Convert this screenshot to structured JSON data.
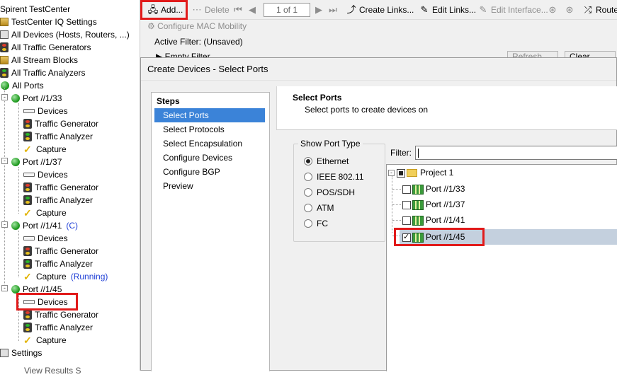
{
  "tree": {
    "root": "Spirent TestCenter",
    "items": [
      {
        "label": "TestCenter IQ Settings",
        "icon": "iq-settings-icon"
      },
      {
        "label": "All Devices (Hosts, Routers, ...)",
        "icon": "devices-folder-icon"
      },
      {
        "label": "All Traffic Generators",
        "icon": "traffic-generator-icon"
      },
      {
        "label": "All Stream Blocks",
        "icon": "stream-blocks-icon"
      },
      {
        "label": "All Traffic Analyzers",
        "icon": "traffic-analyzer-icon"
      },
      {
        "label": "All Ports",
        "icon": "globe-icon"
      }
    ],
    "ports": [
      {
        "label": "Port //1/33",
        "status": "",
        "children": [
          {
            "label": "Devices",
            "status": ""
          },
          {
            "label": "Traffic Generator",
            "status": ""
          },
          {
            "label": "Traffic Analyzer",
            "status": ""
          },
          {
            "label": "Capture",
            "status": ""
          }
        ]
      },
      {
        "label": "Port //1/37",
        "status": "",
        "children": [
          {
            "label": "Devices",
            "status": ""
          },
          {
            "label": "Traffic Generator",
            "status": ""
          },
          {
            "label": "Traffic Analyzer",
            "status": ""
          },
          {
            "label": "Capture",
            "status": ""
          }
        ]
      },
      {
        "label": "Port //1/41",
        "status": "(C)",
        "children": [
          {
            "label": "Devices",
            "status": ""
          },
          {
            "label": "Traffic Generator",
            "status": ""
          },
          {
            "label": "Traffic Analyzer",
            "status": ""
          },
          {
            "label": "Capture",
            "status": "(Running)"
          }
        ]
      },
      {
        "label": "Port //1/45",
        "status": "",
        "children": [
          {
            "label": "Devices",
            "status": ""
          },
          {
            "label": "Traffic Generator",
            "status": ""
          },
          {
            "label": "Traffic Analyzer",
            "status": ""
          },
          {
            "label": "Capture",
            "status": ""
          }
        ]
      }
    ],
    "settings": "Settings",
    "bottom_partial": "View Results S"
  },
  "toolbar": {
    "add": "Add...",
    "delete": "Delete",
    "pager": "1 of 1",
    "create_links": "Create Links...",
    "edit_links": "Edit Links...",
    "edit_interface": "Edit Interface...",
    "route": "Route"
  },
  "sub": {
    "configure_mac": "Configure MAC Mobility",
    "active_filter_label": "Active Filter:",
    "active_filter_value": "(Unsaved)",
    "empty_filter": "Empty Filter",
    "refresh": "Refresh",
    "clear": "Clear"
  },
  "dialog": {
    "title": "Create Devices - Select Ports",
    "steps_header": "Steps",
    "steps": [
      "Select Ports",
      "Select Protocols",
      "Select Encapsulation",
      "Configure Devices",
      "Configure BGP",
      "Preview"
    ],
    "selected_step": 0,
    "header_title": "Select Ports",
    "header_subtitle": "Select ports to create devices on",
    "port_type_legend": "Show Port Type",
    "port_types": [
      "Ethernet",
      "IEEE 802.11",
      "POS/SDH",
      "ATM",
      "FC"
    ],
    "port_type_selected": 0,
    "filter_label": "Filter:",
    "filter_value": "",
    "project": "Project 1",
    "ports": [
      {
        "label": "Port //1/33",
        "checked": false
      },
      {
        "label": "Port //1/37",
        "checked": false
      },
      {
        "label": "Port //1/41",
        "checked": false
      },
      {
        "label": "Port //1/45",
        "checked": true
      }
    ]
  },
  "colors": {
    "highlight": "#e11a1a",
    "selection": "#3b83d8",
    "row_selection": "#c4d0de"
  }
}
